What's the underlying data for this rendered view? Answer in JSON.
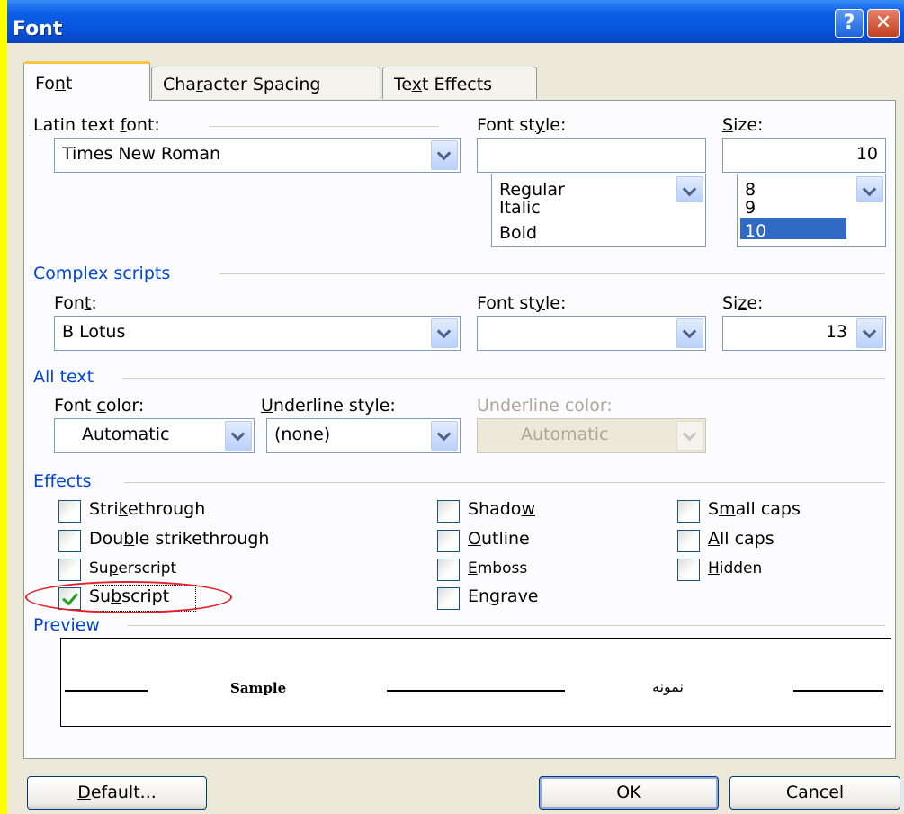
{
  "window": {
    "title": "Font",
    "help_glyph": "?",
    "close_glyph": "✕"
  },
  "tabs": [
    {
      "label_pre": "Fo",
      "label_u": "n",
      "label_post": "t",
      "selected": true
    },
    {
      "label_pre": "Cha",
      "label_u": "r",
      "label_post": "acter Spacing",
      "selected": false
    },
    {
      "label_pre": "Te",
      "label_u": "x",
      "label_post": "t Effects",
      "selected": false
    }
  ],
  "latin": {
    "font_label_pre": "Latin text ",
    "font_label_u": "f",
    "font_label_post": "ont:",
    "font_value": "Times New Roman",
    "style_label_pre": "Font st",
    "style_label_u": "y",
    "style_label_post": "le:",
    "style_value": "",
    "style_options": [
      "Regular",
      "Italic",
      "Bold"
    ],
    "size_label_pre": "",
    "size_label_u": "S",
    "size_label_post": "ize:",
    "size_value": "10",
    "size_options": [
      "8",
      "9",
      "10"
    ],
    "size_selected": "10"
  },
  "complex": {
    "heading": "Complex scripts",
    "font_label_pre": "Fon",
    "font_label_u": "t",
    "font_label_post": ":",
    "font_value": "B Lotus",
    "style_label_pre": "Font st",
    "style_label_u": "y",
    "style_label_post": "le:",
    "style_value": "",
    "size_label_pre": "Si",
    "size_label_u": "z",
    "size_label_post": "e:",
    "size_value": "13"
  },
  "all_text": {
    "heading": "All text",
    "color_label_pre": "Font ",
    "color_label_u": "c",
    "color_label_post": "olor:",
    "color_value": "Automatic",
    "underline_label_pre": "",
    "underline_label_u": "U",
    "underline_label_post": "nderline style:",
    "underline_value": "(none)",
    "underline_color_label": "Underline color:",
    "underline_color_value": "Automatic"
  },
  "effects": {
    "heading": "Effects",
    "items": [
      {
        "pre": "Stri",
        "u": "k",
        "post": "ethrough",
        "checked": false
      },
      {
        "pre": "Dou",
        "u": "b",
        "post": "le strikethrough",
        "checked": false
      },
      {
        "pre": "Su",
        "u": "p",
        "post": "erscript",
        "checked": false
      },
      {
        "pre": "Su",
        "u": "b",
        "post": "script",
        "checked": true
      },
      {
        "pre": "Shado",
        "u": "w",
        "post": "",
        "checked": false
      },
      {
        "pre": "",
        "u": "O",
        "post": "utline",
        "checked": false
      },
      {
        "pre": "",
        "u": "E",
        "post": "mboss",
        "checked": false
      },
      {
        "pre": "En",
        "u": "g",
        "post": "rave",
        "checked": false
      },
      {
        "pre": "S",
        "u": "m",
        "post": "all caps",
        "checked": false
      },
      {
        "pre": "",
        "u": "A",
        "post": "ll caps",
        "checked": false
      },
      {
        "pre": "",
        "u": "H",
        "post": "idden",
        "checked": false
      }
    ]
  },
  "preview": {
    "heading": "Preview",
    "sample_latin": "Sample",
    "sample_complex": "نمونه"
  },
  "buttons": {
    "default_pre": "",
    "default_u": "D",
    "default_post": "efault...",
    "ok": "OK",
    "cancel": "Cancel"
  },
  "colors": {
    "background": "#ffff00",
    "titlebar": "#0855dd",
    "dialog": "#ece9d8",
    "annotation": "#e0202a",
    "check": "#21a121"
  }
}
